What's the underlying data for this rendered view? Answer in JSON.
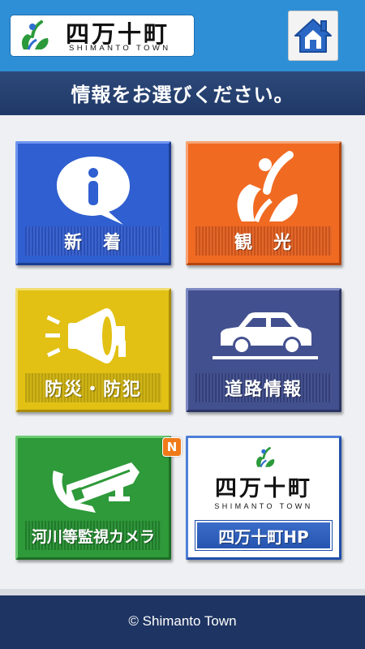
{
  "header": {
    "logo_jp": "四万十町",
    "logo_en": "SHIMANTO TOWN",
    "home_icon": "home-icon",
    "title": "情報をお選びください。"
  },
  "tiles": [
    {
      "label": "新　着",
      "icon": "info-bubble-icon",
      "color": "#2f5fd0"
    },
    {
      "label": "観　光",
      "icon": "town-emblem-icon",
      "color": "#f06a22"
    },
    {
      "label": "防災・防犯",
      "icon": "megaphone-icon",
      "color": "#e2c114"
    },
    {
      "label": "道路情報",
      "icon": "car-icon",
      "color": "#43508f"
    },
    {
      "label": "河川等監視カメラ",
      "icon": "surveillance-camera-icon",
      "color": "#2e9a39",
      "badge": "N"
    },
    {
      "label": "四万十町HP",
      "icon": "town-logo-icon",
      "color": "#2555b0",
      "logo_jp": "四万十町",
      "logo_en": "SHIMANTO TOWN"
    }
  ],
  "footer": {
    "copyright": "© Shimanto Town"
  }
}
